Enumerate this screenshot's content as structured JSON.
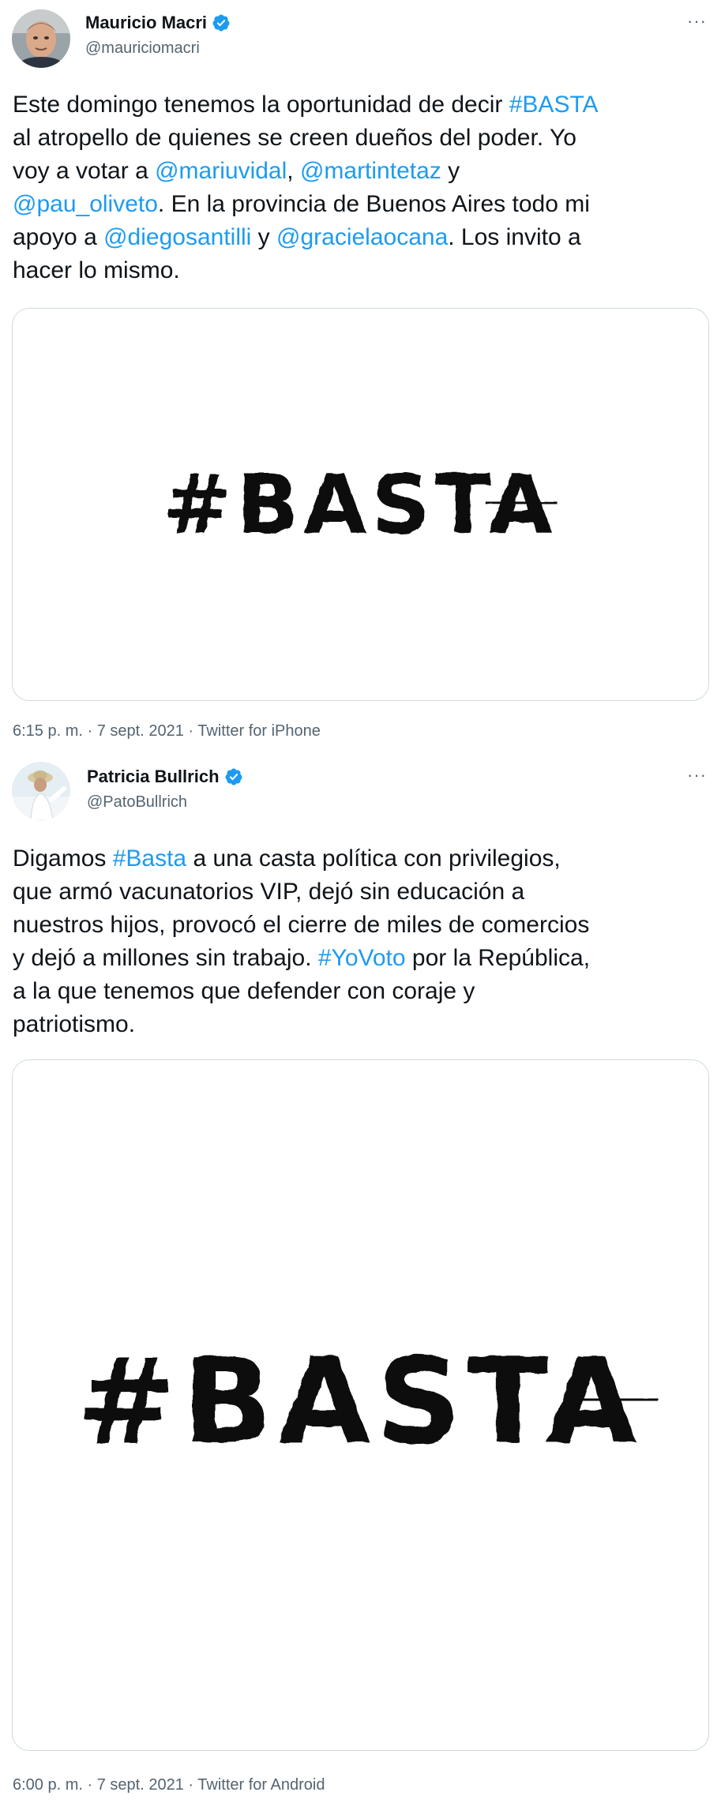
{
  "tweets": [
    {
      "display_name": "Mauricio Macri",
      "handle": "@mauriciomacri",
      "more_label": "···",
      "text_segments": [
        {
          "t": "Este domingo tenemos la oportunidad de decir "
        },
        {
          "t": "#BASTA",
          "link": true
        },
        {
          "t": "\nal atropello de quienes se creen dueños del poder. Yo\nvoy a votar a "
        },
        {
          "t": "@mariuvidal",
          "link": true
        },
        {
          "t": ", "
        },
        {
          "t": "@martintetaz",
          "link": true
        },
        {
          "t": " y\n"
        },
        {
          "t": "@pau_oliveto",
          "link": true
        },
        {
          "t": ". En la provincia de Buenos Aires todo mi\napoyo a "
        },
        {
          "t": "@diegosantilli",
          "link": true
        },
        {
          "t": " y "
        },
        {
          "t": "@gracielaocana",
          "link": true
        },
        {
          "t": ". Los invito a\nhacer lo mismo."
        }
      ],
      "media_text": "#BASTA",
      "time": "6:15 p. m.",
      "date": "7 sept. 2021",
      "source": "Twitter for iPhone",
      "sep": "·"
    },
    {
      "display_name": "Patricia Bullrich",
      "handle": "@PatoBullrich",
      "more_label": "···",
      "text_segments": [
        {
          "t": "Digamos "
        },
        {
          "t": "#Basta",
          "link": true
        },
        {
          "t": " a una casta política con privilegios,\nque armó vacunatorios VIP, dejó sin educación a\nnuestros hijos, provocó el cierre de miles de comercios\ny dejó a millones sin trabajo. "
        },
        {
          "t": "#YoVoto",
          "link": true
        },
        {
          "t": " por la República,\na la que tenemos que defender con coraje y\npatriotismo."
        }
      ],
      "media_text": "#BASTA",
      "time": "6:00 p. m.",
      "date": "7 sept. 2021",
      "source": "Twitter for Android",
      "sep": "·"
    }
  ],
  "colors": {
    "link": "#1d9bf0",
    "verified": "#1d9bf0",
    "secondary_text": "#536471",
    "brush_ink": "#111111"
  }
}
